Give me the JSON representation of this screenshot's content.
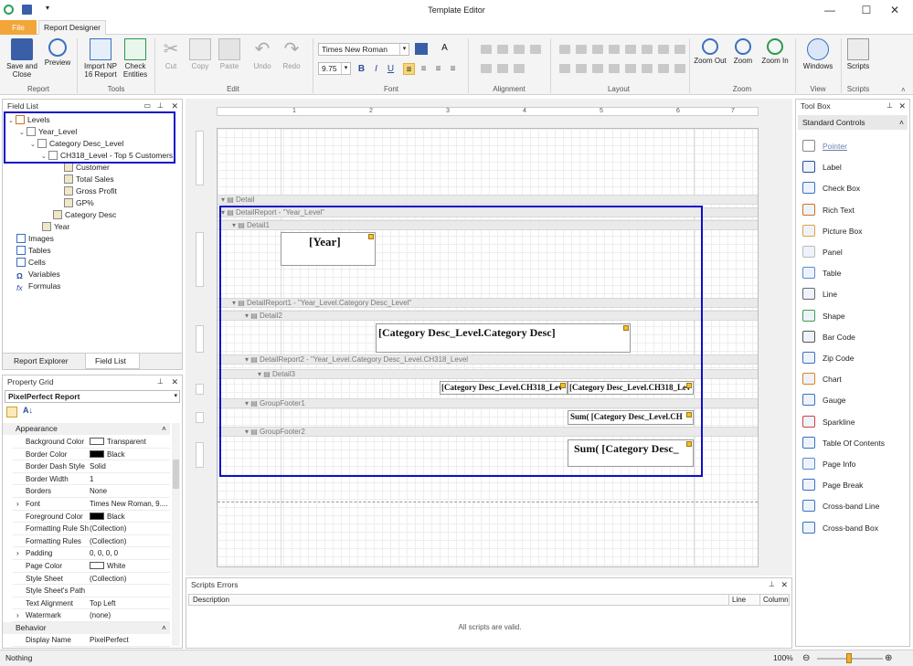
{
  "window": {
    "title": "Template Editor",
    "minimize": "—",
    "maximize": "☐",
    "close": "✕"
  },
  "tabs": {
    "file": "File",
    "report_designer": "Report Designer"
  },
  "ribbon": {
    "save_close": "Save and Close",
    "preview": "Preview",
    "import_np": "Import NP 16 Report",
    "check_entities": "Check Entities",
    "cut": "Cut",
    "copy": "Copy",
    "paste": "Paste",
    "undo": "Undo",
    "redo": "Redo",
    "font_name": "Times New Roman",
    "font_size": "9.75",
    "zoom_out": "Zoom Out",
    "zoom": "Zoom",
    "zoom_in": "Zoom In",
    "windows": "Windows",
    "scripts": "Scripts",
    "groups": {
      "report": "Report",
      "tools": "Tools",
      "edit": "Edit",
      "font": "Font",
      "alignment": "Alignment",
      "layout": "Layout",
      "zoom": "Zoom",
      "view": "View",
      "scripts": "Scripts"
    }
  },
  "field_list": {
    "title": "Field List",
    "nodes": [
      "Levels",
      "Year_Level",
      "Category Desc_Level",
      "CH318_Level - Top 5 Customers",
      "Customer",
      "Total Sales",
      "Gross Profit",
      "GP%",
      "Category Desc",
      "Year",
      "Images",
      "Tables",
      "Cells",
      "Variables",
      "Formulas"
    ],
    "tab_explorer": "Report Explorer",
    "tab_fieldlist": "Field List"
  },
  "property_grid": {
    "title": "Property Grid",
    "object": "PixelPerfect  Report",
    "cat_appearance": "Appearance",
    "cat_behavior": "Behavior",
    "rows": [
      {
        "k": "Background Color",
        "v": "Transparent"
      },
      {
        "k": "Border Color",
        "v": "Black"
      },
      {
        "k": "Border Dash Style",
        "v": "Solid"
      },
      {
        "k": "Border Width",
        "v": "1"
      },
      {
        "k": "Borders",
        "v": "None"
      },
      {
        "k": "Font",
        "v": "Times New Roman, 9...."
      },
      {
        "k": "Foreground Color",
        "v": "Black"
      },
      {
        "k": "Formatting Rule Sh",
        "v": "(Collection)"
      },
      {
        "k": "Formatting Rules",
        "v": "(Collection)"
      },
      {
        "k": "Padding",
        "v": "0, 0, 0, 0"
      },
      {
        "k": "Page Color",
        "v": "White"
      },
      {
        "k": "Style Sheet",
        "v": "(Collection)"
      },
      {
        "k": "Style Sheet's Path",
        "v": ""
      },
      {
        "k": "Text Alignment",
        "v": "Top Left"
      },
      {
        "k": "Watermark",
        "v": "(none)"
      }
    ],
    "display_name_k": "Display Name",
    "display_name_v": "PixelPerfect"
  },
  "designer": {
    "ruler": [
      "1",
      "2",
      "3",
      "4",
      "5",
      "6",
      "7"
    ],
    "bands": {
      "detail": "Detail",
      "detail_report": "DetailReport - \"Year_Level\"",
      "detail1": "Detail1",
      "detail_report1": "DetailReport1 - \"Year_Level.Category Desc_Level\"",
      "detail2": "Detail2",
      "detail_report2": "DetailReport2 - \"Year_Level.Category Desc_Level.CH318_Level",
      "detail3": "Detail3",
      "group_footer1": "GroupFooter1",
      "group_footer2": "GroupFooter2"
    },
    "fields": {
      "year": "[Year]",
      "category": "[Category Desc_Level.Category Desc]",
      "ch318_a": "[Category Desc_Level.CH318_Lev",
      "ch318_b": "[Category Desc_Level.CH318_Lev",
      "sum1": "Sum( [Category Desc_Level.CH",
      "sum2": "Sum( [Category Desc_"
    }
  },
  "scripts_errors": {
    "title": "Scripts Errors",
    "col_desc": "Description",
    "col_line": "Line",
    "col_col": "Column",
    "message": "All scripts are valid."
  },
  "toolbox": {
    "title": "Tool Box",
    "section": "Standard Controls",
    "items": [
      "Pointer",
      "Label",
      "Check Box",
      "Rich Text",
      "Picture Box",
      "Panel",
      "Table",
      "Line",
      "Shape",
      "Bar Code",
      "Zip Code",
      "Chart",
      "Gauge",
      "Sparkline",
      "Table Of Contents",
      "Page Info",
      "Page Break",
      "Cross-band Line",
      "Cross-band Box"
    ]
  },
  "status": {
    "left": "Nothing",
    "zoom": "100%"
  }
}
